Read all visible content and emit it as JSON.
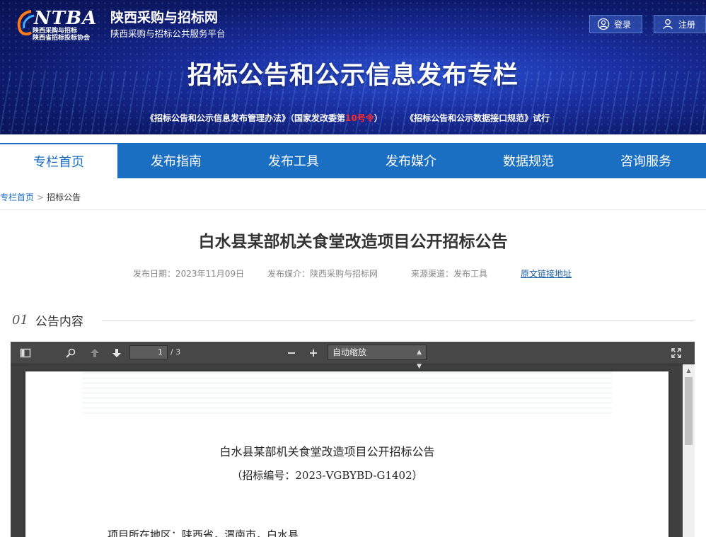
{
  "header": {
    "logo_word": "NTBA",
    "logo_sub1": "陕西采购与招标",
    "logo_sub2": "陕西省招标投标协会",
    "site_title": "陕西采购与招标网",
    "site_subtitle": "陕西采购与招标公共服务平台",
    "login_label": "登录",
    "register_label": "注册",
    "banner_title": "招标公告和公示信息发布专栏",
    "link1_pre": "《招标公告和公示信息发布管理办法》（国家发改委第",
    "link1_red": "10号令",
    "link1_post": "）",
    "link2": "《招标公告和公示数据接口规范》试行"
  },
  "nav": {
    "items": [
      "专栏首页",
      "发布指南",
      "发布工具",
      "发布媒介",
      "数据规范",
      "咨询服务"
    ],
    "active": "专栏首页"
  },
  "breadcrumb": {
    "home": "专栏首页",
    "sep": ">",
    "current": "招标公告"
  },
  "article": {
    "title": "白水县某部机关食堂改造项目公开招标公告",
    "date": "发布日期：2023年11月09日",
    "media": "发布媒介：陕西采购与招标网",
    "channel": "来源渠道：发布工具",
    "source_link": "原文链接地址"
  },
  "section": {
    "number": "01",
    "label": "公告内容"
  },
  "pdf_viewer": {
    "page_current": "1",
    "page_total": "/ 3",
    "zoom": "自动缩放",
    "doc_title": "白水县某部机关食堂改造项目公开招标公告",
    "doc_code": "（招标编号：2023-VGBYBD-G1402）",
    "doc_line1": "项目所在地区：陕西省，渭南市，白水县"
  },
  "colors": {
    "primary": "#1b6fc3",
    "banner_dark": "#0d1a6a",
    "red": "#ff2a2a",
    "viewer_bg": "#404040"
  }
}
